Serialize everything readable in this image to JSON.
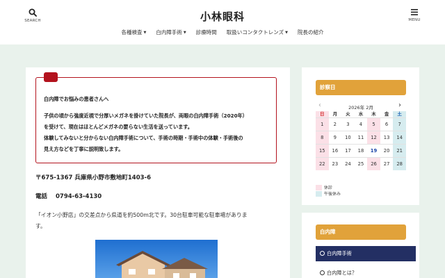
{
  "header": {
    "site_title": "小林眼科",
    "search_label": "SEARCH",
    "menu_label": "MENU",
    "nav": [
      {
        "label": "各種検査",
        "has_submenu": true
      },
      {
        "label": "白内障手術",
        "has_submenu": true
      },
      {
        "label": "診療時間",
        "has_submenu": false
      },
      {
        "label": "取扱いコンタクトレンズ",
        "has_submenu": true
      },
      {
        "label": "院長の紹介",
        "has_submenu": false
      }
    ]
  },
  "main": {
    "notice": {
      "heading": "白内障でお悩みの患者さんへ",
      "line1": "子供の頃から強度近視で分厚いメガネを掛けていた院長が、両眼の白内障手術（2020年）",
      "line2": "を受けて、現在はほとんどメガネの要らない生活を送っています。",
      "line3": "体験してみないと分からない白内障手術について、手術の時期・手術中の体験・手術後の",
      "line4": "見え方などを丁寧に説明致します。"
    },
    "address": "〒675-1367 兵庫県小野市敷地町1403-6",
    "tel_label": "電話",
    "tel_number": "0794-63-4130",
    "access_line1": "「イオン小野店」の交差点から県道を約500m北です。30台駐車可能な駐車場がありま",
    "access_line2": "す。"
  },
  "sidebar": {
    "calendar": {
      "heading": "診察日",
      "month_label": "2026年 2月",
      "weekdays": [
        "日",
        "月",
        "火",
        "水",
        "木",
        "金",
        "土"
      ],
      "weeks": [
        [
          "1",
          "2",
          "3",
          "4",
          "5",
          "6",
          "7"
        ],
        [
          "8",
          "9",
          "10",
          "11",
          "12",
          "13",
          "14"
        ],
        [
          "15",
          "16",
          "17",
          "18",
          "19",
          "20",
          "21"
        ],
        [
          "22",
          "23",
          "24",
          "25",
          "26",
          "27",
          "28"
        ]
      ],
      "today": "19",
      "legend_closed": "休診",
      "legend_afternoon_off": "午後休み",
      "colors": {
        "closed": "#fbe0e7",
        "afternoon_off": "#d6ecef"
      }
    },
    "cataract": {
      "heading": "白内障",
      "links": [
        {
          "label": "白内障手術",
          "active": true
        },
        {
          "label": "白内障とは？",
          "active": false
        }
      ]
    }
  },
  "colors": {
    "accent_red": "#b3121d",
    "sidebar_heading": "#e1a23a",
    "active_link": "#232f63",
    "page_background": "#e9f2ec"
  },
  "icons": {
    "search": "search-icon",
    "menu": "hamburger-menu-icon",
    "prev": "chevron-left-icon",
    "next": "chevron-right-icon"
  }
}
